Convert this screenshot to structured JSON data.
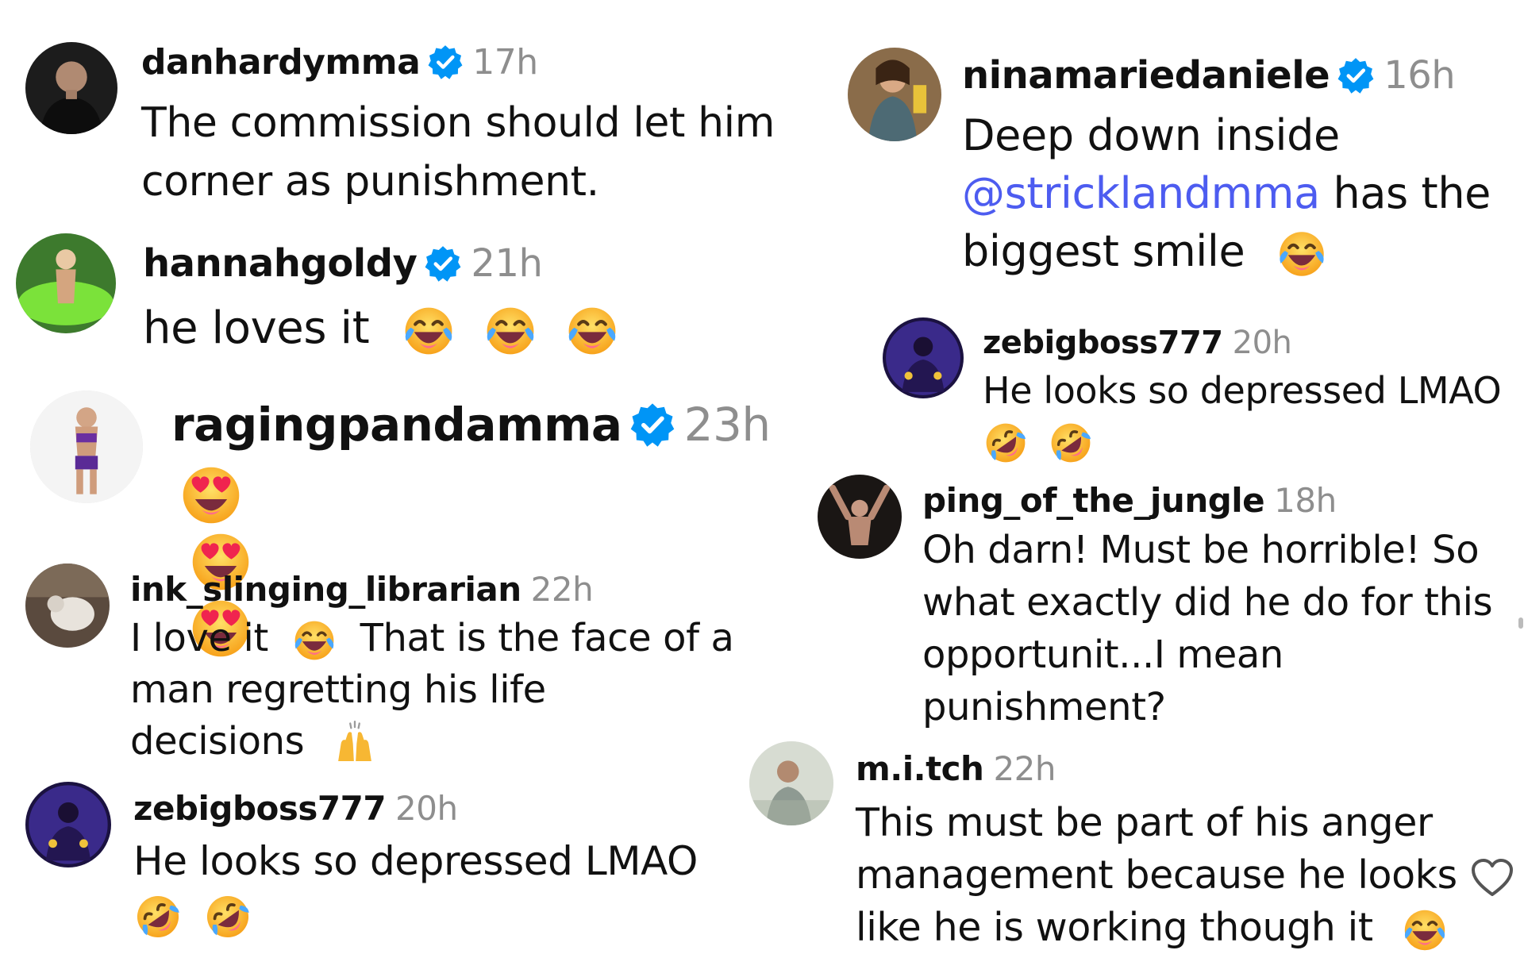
{
  "comments": [
    {
      "username": "danhardymma",
      "verified": true,
      "time": "17h",
      "lines": [
        "The commission should let him",
        "corner as punishment."
      ]
    },
    {
      "username": "hannahgoldy",
      "verified": true,
      "time": "21h",
      "text": "he loves it",
      "emojis": [
        "joy-emoji",
        "joy-emoji",
        "joy-emoji"
      ]
    },
    {
      "username": "ragingpandamma",
      "verified": true,
      "time": "23h",
      "emojis": [
        "heart-eyes-emoji",
        "heart-eyes-emoji",
        "heart-eyes-emoji"
      ]
    },
    {
      "username": "ink_slinging_librarian",
      "verified": false,
      "time": "22h",
      "line1_a": "I love it",
      "line1_b": "That is the face of a",
      "line2": "man regretting his life",
      "line3": "decisions",
      "emojis": [
        "joy-emoji",
        "raised-hands-emoji"
      ]
    },
    {
      "username": "zebigboss777",
      "verified": false,
      "time": "20h",
      "text": "He looks so depressed LMAO",
      "emojis": [
        "rofl-emoji",
        "rofl-emoji"
      ]
    },
    {
      "username": "ninamariedaniele",
      "verified": true,
      "time": "16h",
      "line1": "Deep down inside",
      "mention": "@stricklandmma",
      "line2_rest": "has the",
      "line3": "biggest smile",
      "emojis": [
        "joy-emoji"
      ]
    },
    {
      "username": "zebigboss777",
      "verified": false,
      "time": "20h",
      "text": "He looks so depressed LMAO",
      "emojis": [
        "rofl-emoji",
        "rofl-emoji"
      ]
    },
    {
      "username": "ping_of_the_jungle",
      "verified": false,
      "time": "18h",
      "lines": [
        "Oh darn! Must be horrible! So",
        "what exactly did he do for this",
        "opportunit...I mean",
        "punishment?"
      ]
    },
    {
      "username": "m.i.tch",
      "verified": false,
      "time": "22h",
      "lines": [
        "This must be part of his anger",
        "management because he looks"
      ],
      "line3": "like he is working though it",
      "emojis": [
        "joy-emoji"
      ]
    }
  ],
  "actions": {
    "like_icon": "heart-outline-icon"
  },
  "colors": {
    "verified": "#0095f6",
    "mention": "#4d5cf0",
    "timestamp": "#8e8e8e",
    "text": "#111111"
  }
}
